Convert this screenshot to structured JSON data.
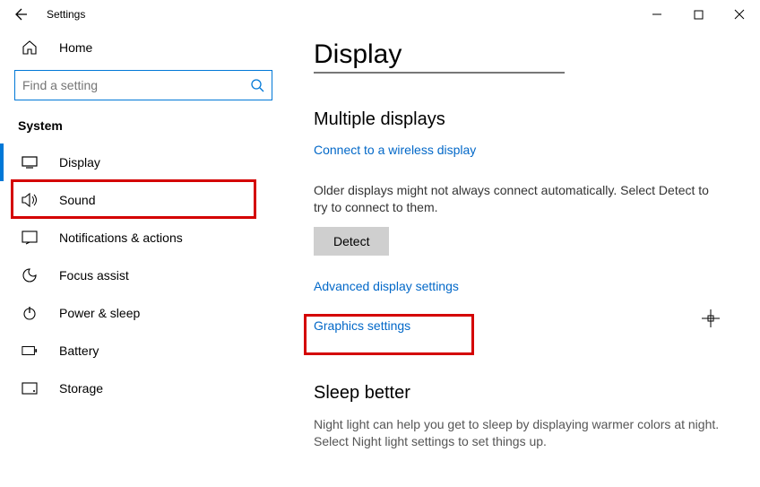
{
  "window": {
    "title": "Settings"
  },
  "sidebar": {
    "home": "Home",
    "searchPlaceholder": "Find a setting",
    "groupLabel": "System",
    "items": [
      {
        "label": "Display"
      },
      {
        "label": "Sound"
      },
      {
        "label": "Notifications & actions"
      },
      {
        "label": "Focus assist"
      },
      {
        "label": "Power & sleep"
      },
      {
        "label": "Battery"
      },
      {
        "label": "Storage"
      }
    ]
  },
  "content": {
    "pageTitle": "Display",
    "multiHeading": "Multiple displays",
    "wirelessLink": "Connect to a wireless display",
    "detectNote": "Older displays might not always connect automatically. Select Detect to try to connect to them.",
    "detectLabel": "Detect",
    "advancedLink": "Advanced display settings",
    "graphicsLink": "Graphics settings",
    "sleepHeading": "Sleep better",
    "sleepNote": "Night light can help you get to sleep by displaying warmer colors at night. Select Night light settings to set things up."
  }
}
